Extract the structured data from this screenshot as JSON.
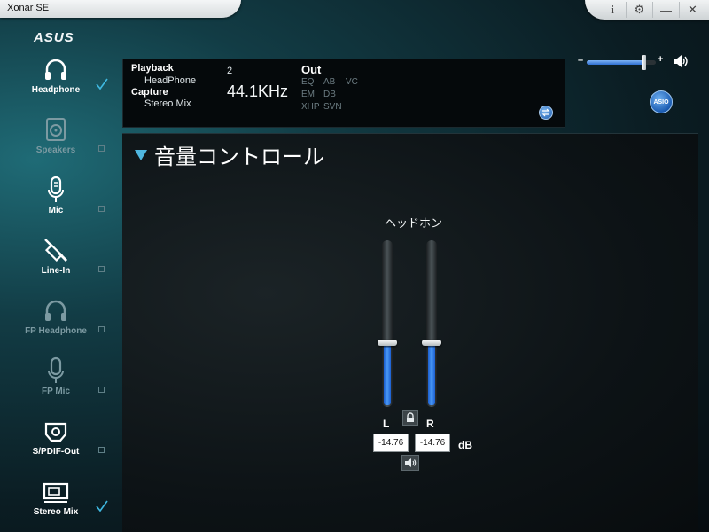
{
  "window": {
    "title": "Xonar SE",
    "controls": [
      "i",
      "⚙",
      "—",
      "✕"
    ]
  },
  "brand": {
    "logo": "ASUS"
  },
  "sidebar": {
    "items": [
      {
        "label": "Headphone",
        "icon": "headphone-icon",
        "state": "active",
        "checked": true
      },
      {
        "label": "Speakers",
        "icon": "speaker-icon",
        "state": "dim",
        "checked": false
      },
      {
        "label": "Mic",
        "icon": "mic-icon",
        "state": "active",
        "checked": false
      },
      {
        "label": "Line-In",
        "icon": "line-in-jack-icon",
        "state": "active",
        "checked": false
      },
      {
        "label": "FP Headphone",
        "icon": "headphone-icon",
        "state": "dim",
        "checked": false
      },
      {
        "label": "FP Mic",
        "icon": "mic-icon",
        "state": "dim",
        "checked": false
      },
      {
        "label": "S/PDIF-Out",
        "icon": "spdif-icon",
        "state": "active",
        "checked": false
      },
      {
        "label": "Stereo Mix",
        "icon": "stereo-mix-icon",
        "state": "active",
        "checked": true
      }
    ]
  },
  "info": {
    "playback_label": "Playback",
    "playback_device": "HeadPhone",
    "capture_label": "Capture",
    "capture_device": "Stereo Mix",
    "channels": "2",
    "sample_rate": "44.1KHz",
    "out_label": "Out",
    "fx_row1": [
      "EQ",
      "AB",
      "VC"
    ],
    "fx_row2": [
      "EM",
      "DB"
    ],
    "fx_row3": [
      "XHP",
      "SVN"
    ]
  },
  "master_volume": {
    "minus": "–",
    "plus": "+",
    "level": 0.82
  },
  "asio": {
    "label": "ASIO"
  },
  "volume_control": {
    "title": "音量コントロール",
    "device": "ヘッドホン",
    "left_label": "L",
    "right_label": "R",
    "left_db": "-14.76",
    "right_db": "-14.76",
    "unit": "dB",
    "left_level": 0.38,
    "right_level": 0.38
  },
  "colors": {
    "accent": "#4fb7e0",
    "check": "#3fb8e0",
    "slider_fill": "#3a88ee"
  }
}
